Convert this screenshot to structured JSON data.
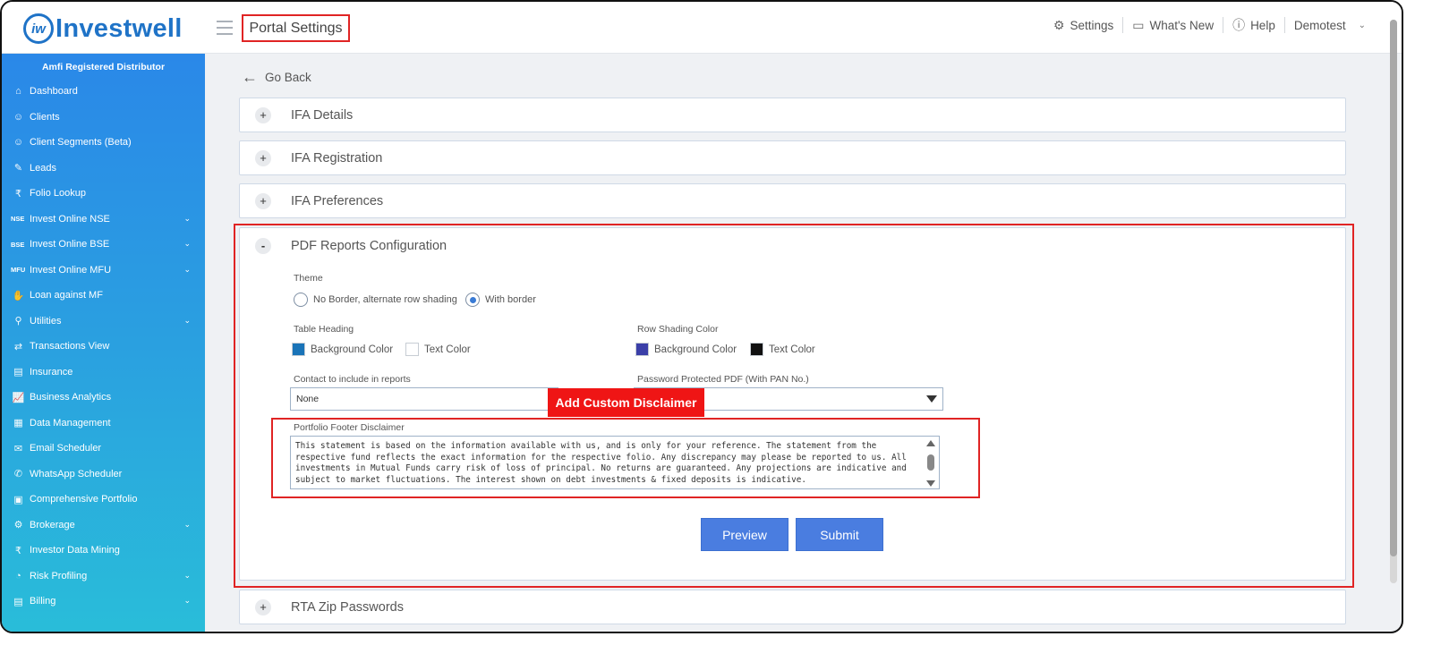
{
  "header": {
    "logo_badge": "iw",
    "logo_text": "Investwell",
    "page_title": "Portal Settings",
    "nav": [
      {
        "label": "Settings",
        "icon": "gear-icon",
        "glyph": "⚙"
      },
      {
        "label": "What's New",
        "icon": "chat-icon",
        "glyph": "▭"
      },
      {
        "label": "Help",
        "icon": "info-icon",
        "glyph": "ⓘ"
      },
      {
        "label": "Demotest",
        "icon": "",
        "glyph": ""
      }
    ]
  },
  "sidebar": {
    "top_label": "Amfi Registered Distributor",
    "items": [
      {
        "label": "Dashboard",
        "icon": "home-icon",
        "glyph": "⌂",
        "expandable": false
      },
      {
        "label": "Clients",
        "icon": "users-icon",
        "glyph": "☺",
        "expandable": false
      },
      {
        "label": "Client Segments (Beta)",
        "icon": "segments-icon",
        "glyph": "☺",
        "expandable": false
      },
      {
        "label": "Leads",
        "icon": "leads-icon",
        "glyph": "✎",
        "expandable": false
      },
      {
        "label": "Folio Lookup",
        "icon": "folio-icon",
        "glyph": "₹",
        "expandable": false
      },
      {
        "label": "Invest Online NSE",
        "icon": "nse-icon",
        "tag": "NSE",
        "expandable": true
      },
      {
        "label": "Invest Online BSE",
        "icon": "bse-icon",
        "tag": "BSE",
        "expandable": true
      },
      {
        "label": "Invest Online MFU",
        "icon": "mfu-icon",
        "tag": "MFU",
        "expandable": true
      },
      {
        "label": "Loan against MF",
        "icon": "loan-icon",
        "glyph": "✋",
        "expandable": false
      },
      {
        "label": "Utilities",
        "icon": "utilities-icon",
        "glyph": "⚲",
        "expandable": true
      },
      {
        "label": "Transactions View",
        "icon": "transactions-icon",
        "glyph": "⇄",
        "expandable": false
      },
      {
        "label": "Insurance",
        "icon": "insurance-icon",
        "glyph": "▤",
        "expandable": false
      },
      {
        "label": "Business Analytics",
        "icon": "analytics-icon",
        "glyph": "📈",
        "expandable": false
      },
      {
        "label": "Data Management",
        "icon": "data-icon",
        "glyph": "▦",
        "expandable": false
      },
      {
        "label": "Email Scheduler",
        "icon": "email-icon",
        "glyph": "✉",
        "expandable": false
      },
      {
        "label": "WhatsApp Scheduler",
        "icon": "whatsapp-icon",
        "glyph": "✆",
        "expandable": false
      },
      {
        "label": "Comprehensive Portfolio",
        "icon": "portfolio-icon",
        "glyph": "▣",
        "expandable": false
      },
      {
        "label": "Brokerage",
        "icon": "brokerage-icon",
        "glyph": "⚙",
        "expandable": true
      },
      {
        "label": "Investor Data Mining",
        "icon": "mining-icon",
        "glyph": "₹",
        "expandable": false
      },
      {
        "label": "Risk Profiling",
        "icon": "risk-icon",
        "glyph": "◔",
        "expandable": true
      },
      {
        "label": "Billing",
        "icon": "billing-icon",
        "glyph": "▤",
        "expandable": true
      }
    ]
  },
  "main": {
    "go_back": "Go Back",
    "sections": [
      {
        "label": "IFA Details",
        "toggle": "+"
      },
      {
        "label": "IFA Registration",
        "toggle": "+"
      },
      {
        "label": "IFA Preferences",
        "toggle": "+"
      }
    ],
    "pdf": {
      "label": "PDF Reports Configuration",
      "toggle": "-",
      "theme_label": "Theme",
      "theme_options": [
        "No Border, alternate row shading",
        "With border"
      ],
      "theme_selected": "With border",
      "table_heading_label": "Table Heading",
      "row_shading_label": "Row Shading Color",
      "bg_color_label": "Background Color",
      "text_color_label": "Text Color",
      "colors": {
        "table_heading_bg": "#1a74b8",
        "table_heading_text": "#ffffff",
        "row_shading_bg": "#3b3fa8",
        "row_shading_text": "#111111"
      },
      "contact_label": "Contact to include in reports",
      "contact_value": "None",
      "password_label": "Password Protected PDF (With PAN No.)",
      "password_value": "",
      "callout": "Add Custom Disclaimer",
      "disclaimer_label": "Portfolio Footer Disclaimer",
      "disclaimer_text": "This statement is based on the information available with us, and is only for your reference. The statement from the respective fund reflects the exact information for the respective folio. Any discrepancy may please be reported to us. All investments in Mutual Funds carry risk of loss of principal. No returns are guaranteed. Any projections are indicative and subject to market fluctuations. The interest shown on debt investments & fixed deposits is indicative.",
      "preview_label": "Preview",
      "submit_label": "Submit"
    },
    "rta_section": {
      "label": "RTA Zip Passwords",
      "toggle": "+"
    }
  }
}
